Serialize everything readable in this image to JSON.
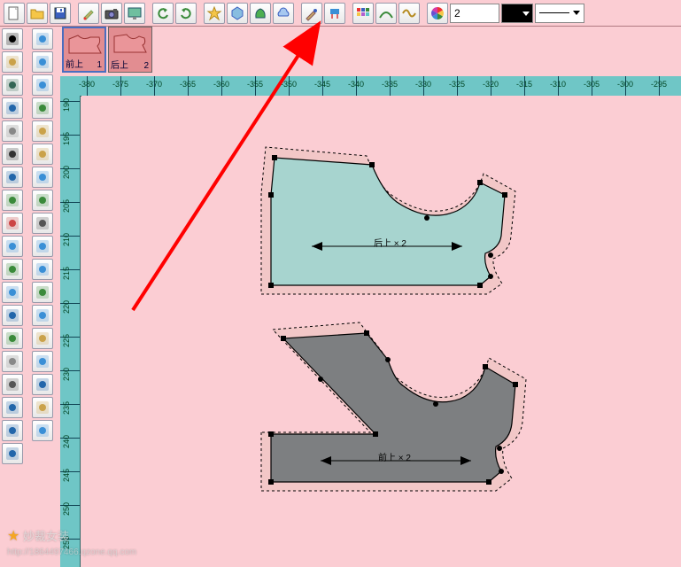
{
  "top_toolbar": {
    "new_icon": "new",
    "open_icon": "open",
    "save_icon": "save",
    "paint_icon": "paint",
    "camera_icon": "camera",
    "screen_icon": "screen",
    "undo_icon": "undo",
    "redo_icon": "redo",
    "star_icon": "star",
    "poly_icon": "polygon",
    "shape_green_icon": "shape-green",
    "shape_cloud_icon": "shape-cloud",
    "brush_icon": "brush",
    "tool_blue_icon": "tool-blue",
    "palette_icon": "palette",
    "curve1_icon": "curve1",
    "curve2_icon": "curve2",
    "color_wheel_icon": "color",
    "num_value": "2",
    "color_value": "#000000",
    "line_style": "solid"
  },
  "thumbs": [
    {
      "label": "前上",
      "num": "1",
      "fill": "#ea9599",
      "sel": true
    },
    {
      "label": "后上",
      "num": "2",
      "fill": "#ea9599",
      "sel": false
    }
  ],
  "left_toolbar": [
    "pointer",
    "pencil",
    "rect",
    "node-edit",
    "measure",
    "glasses",
    "compass",
    "scissors-green",
    "hanger",
    "fold",
    "flag",
    "layer",
    "spiral",
    "circle-tool",
    "page",
    "scissors",
    "wave",
    "hash",
    "t-tool"
  ],
  "mid_toolbar": [
    "piece-blue",
    "pocket",
    "arc",
    "piece-green",
    "dart",
    "ruler",
    "button",
    "sewing",
    "machine",
    "seam",
    "align",
    "mirror",
    "piece-curve",
    "rotate",
    "lock",
    "dashed",
    "grid",
    "tile"
  ],
  "ruler": {
    "h": [
      "-380",
      "-375",
      "-370",
      "-365",
      "-360",
      "-355",
      "-350",
      "-345",
      "-340",
      "-335",
      "-330",
      "-325",
      "-320",
      "-315",
      "-310",
      "-305",
      "-300",
      "-295"
    ],
    "v": [
      "190",
      "195",
      "200",
      "205",
      "210",
      "215",
      "220",
      "225",
      "230",
      "235",
      "240",
      "245",
      "250",
      "255"
    ]
  },
  "pieces": {
    "back": {
      "label": "后上 × 2"
    },
    "front": {
      "label": "前上 × 2"
    }
  },
  "watermark": {
    "title": "妙裁女装",
    "sub": "http://1864497466.qzone.qq.com"
  }
}
